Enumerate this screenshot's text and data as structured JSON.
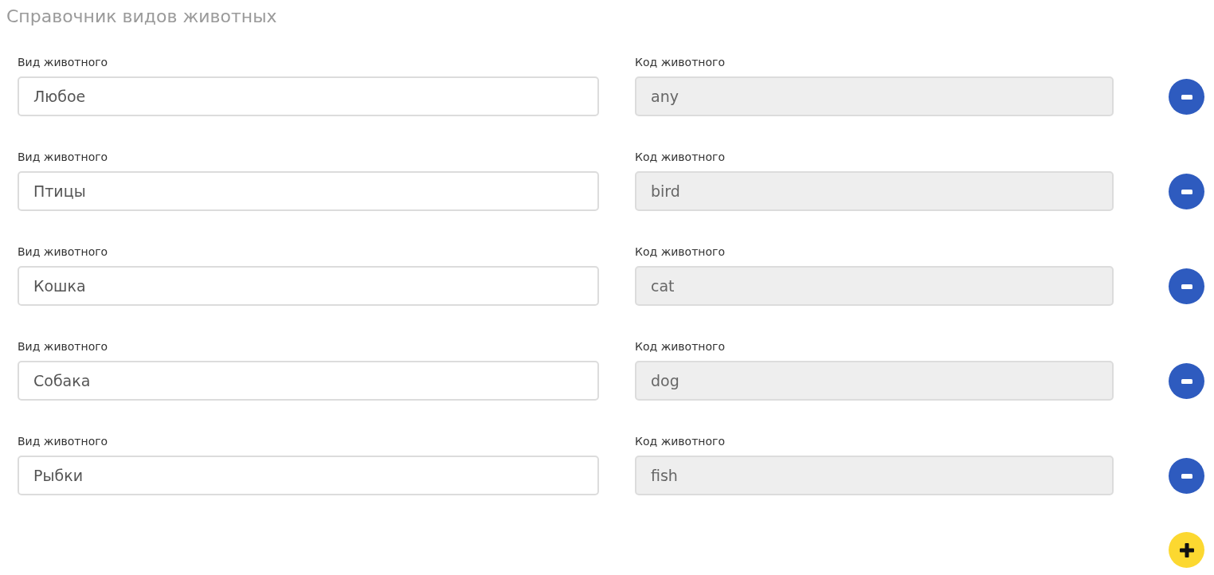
{
  "title": "Справочник видов животных",
  "rows": [
    {
      "name": {
        "label": "Вид животного",
        "value": "Любое",
        "disabled": false
      },
      "code": {
        "label": "Код животного",
        "value": "any",
        "disabled": true
      }
    },
    {
      "name": {
        "label": "Вид животного",
        "value": "Птицы",
        "disabled": false
      },
      "code": {
        "label": "Код животного",
        "value": "bird",
        "disabled": true
      }
    },
    {
      "name": {
        "label": "Вид животного",
        "value": "Кошка",
        "disabled": false
      },
      "code": {
        "label": "Код животного",
        "value": "cat",
        "disabled": true
      }
    },
    {
      "name": {
        "label": "Вид животного",
        "value": "Собака",
        "disabled": false
      },
      "code": {
        "label": "Код животного",
        "value": "dog",
        "disabled": true
      }
    },
    {
      "name": {
        "label": "Вид животного",
        "value": "Рыбки",
        "disabled": false
      },
      "code": {
        "label": "Код животного",
        "value": "fish",
        "disabled": true
      }
    }
  ]
}
